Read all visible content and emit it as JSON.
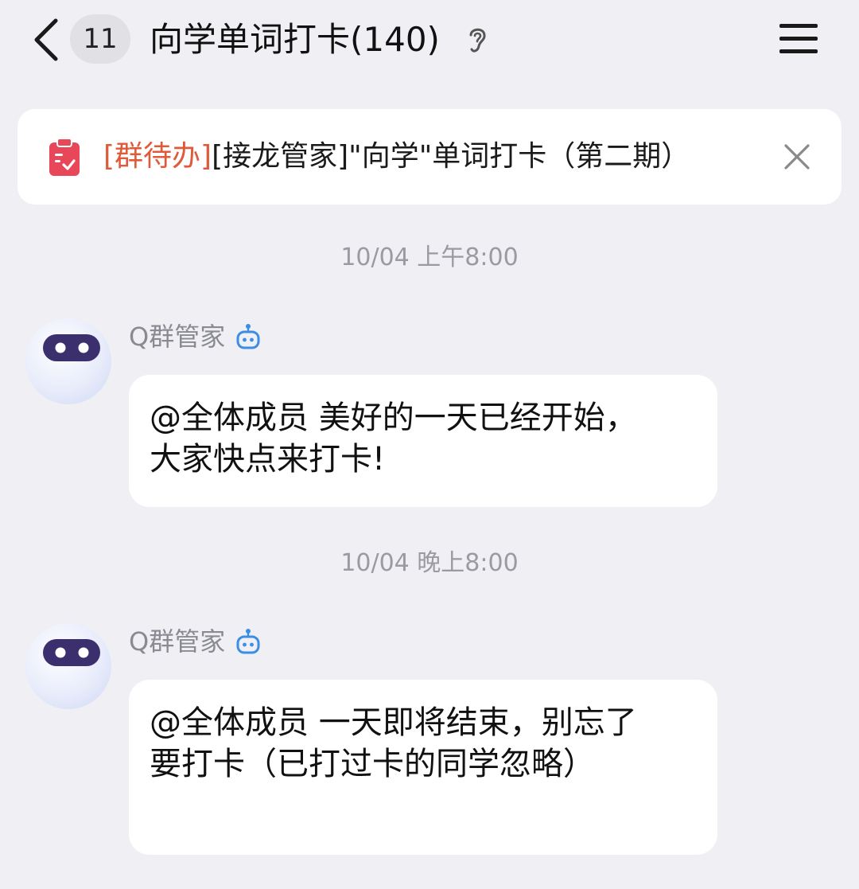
{
  "header": {
    "unread_count": "11",
    "title": "向学单词打卡(140)",
    "back_icon": "chevron-left-icon",
    "mode_icon": "ear-icon",
    "menu_icon": "hamburger-menu-icon"
  },
  "todo_banner": {
    "tag": "[群待办]",
    "text": "[接龙管家]\"向学\"单词打卡（第二期）",
    "icon": "clipboard-check-icon",
    "close_icon": "close-icon",
    "tag_color": "#e05a3a",
    "icon_color": "#e8475a"
  },
  "messages": [
    {
      "timestamp": "10/04 上午8:00",
      "sender": "Q群管家",
      "sender_badge": "robot-icon",
      "text": "@全体成员 美好的一天已经开始，大家快点来打卡!"
    },
    {
      "timestamp": "10/04 晚上8:00",
      "sender": "Q群管家",
      "sender_badge": "robot-icon",
      "text": "@全体成员 一天即将结束，别忘了要打卡（已打过卡的同学忽略）"
    }
  ],
  "colors": {
    "background": "#efeff4",
    "bot_badge": "#3a8ee6"
  }
}
